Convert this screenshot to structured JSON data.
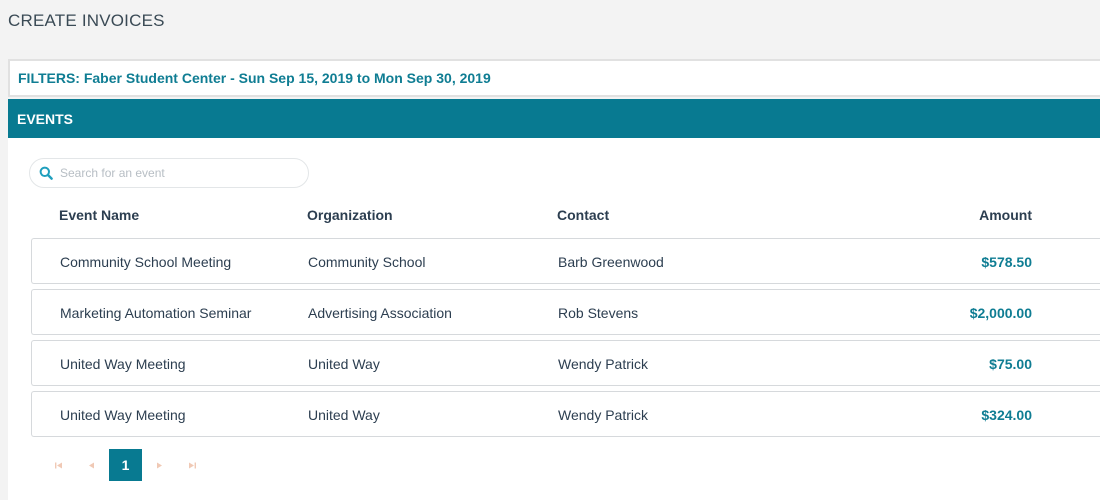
{
  "page": {
    "title": "CREATE INVOICES"
  },
  "filters": {
    "text": "FILTERS: Faber Student Center - Sun Sep 15, 2019 to Mon Sep 30, 2019"
  },
  "events": {
    "header": "EVENTS",
    "search": {
      "placeholder": "Search for an event",
      "value": "",
      "icon": "search-icon"
    },
    "columns": [
      "Event Name",
      "Organization",
      "Contact",
      "Amount"
    ],
    "rows": [
      [
        "Community School Meeting",
        "Community School",
        "Barb Greenwood",
        "$578.50"
      ],
      [
        "Marketing Automation Seminar",
        "Advertising Association",
        "Rob Stevens",
        "$2,000.00"
      ],
      [
        "United Way Meeting",
        "United Way",
        "Wendy Patrick",
        "$75.00"
      ],
      [
        "United Way Meeting",
        "United Way",
        "Wendy Patrick",
        "$324.00"
      ]
    ]
  },
  "pagination": {
    "first_icon": "first-page-icon",
    "prev_icon": "previous-page-icon",
    "current_page": "1",
    "next_icon": "next-page-icon",
    "last_icon": "last-page-icon"
  },
  "colors": {
    "accent": "#087a91",
    "accent_text": "#0f7d93",
    "pager_disabled": "#f0c9b5"
  }
}
